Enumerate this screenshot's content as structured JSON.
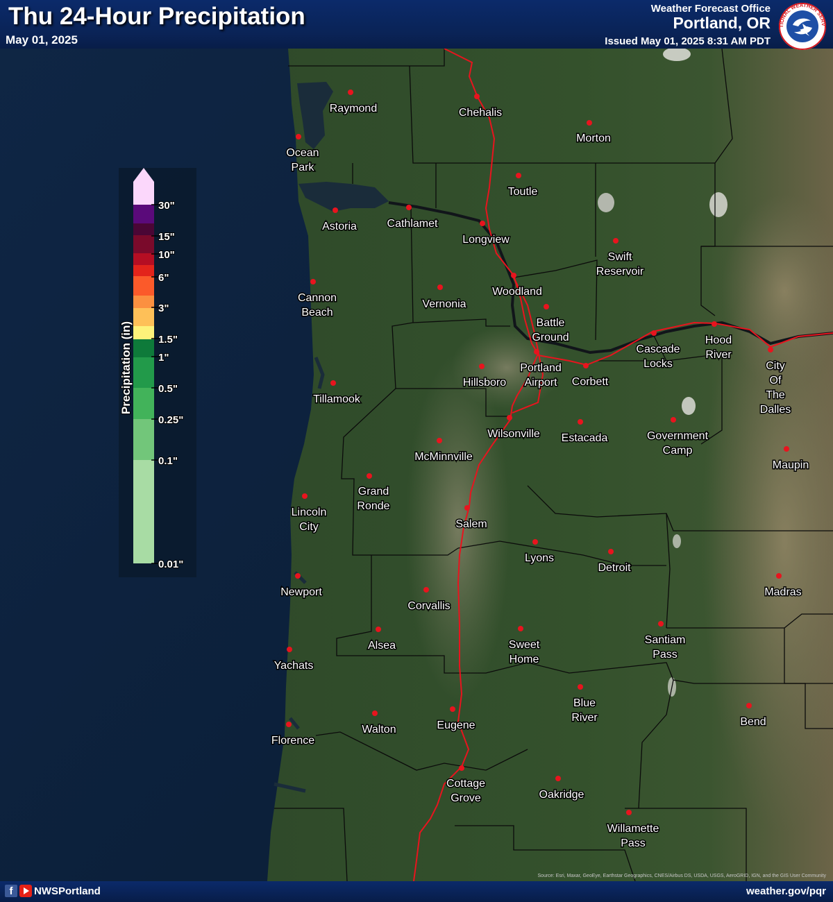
{
  "header": {
    "title": "Thu 24-Hour Precipitation",
    "date": "May 01, 2025",
    "office_line1": "Weather Forecast Office",
    "office_line2": "Portland, OR",
    "issued": "Issued May 01, 2025 8:31 AM PDT"
  },
  "logo_text": "NATIONAL WEATHER SERVICE",
  "legend": {
    "title": "Precipitation (in)",
    "ticks": [
      "30\"",
      "15\"",
      "10\"",
      "6\"",
      "3\"",
      "1.5\"",
      "1\"",
      "0.5\"",
      "0.25\"",
      "0.1\"",
      "0.01\""
    ],
    "colors": [
      "#fbd7fb",
      "#5a0a7a",
      "#4a0635",
      "#7a0a2b",
      "#b50e23",
      "#e3241b",
      "#fb5a2a",
      "#fb9040",
      "#fec058",
      "#fdf27a",
      "#0e7a3a",
      "#229a4a",
      "#42b35a",
      "#72c67a",
      "#a8dca4",
      "#cde9c5"
    ]
  },
  "cities": [
    {
      "name": "Raymond",
      "line2": ""
    },
    {
      "name": "Chehalis",
      "line2": ""
    },
    {
      "name": "Morton",
      "line2": ""
    },
    {
      "name": "Ocean",
      "line2": "Park"
    },
    {
      "name": "Toutle",
      "line2": ""
    },
    {
      "name": "Astoria",
      "line2": ""
    },
    {
      "name": "Cathlamet",
      "line2": ""
    },
    {
      "name": "Longview",
      "line2": ""
    },
    {
      "name": "Swift",
      "line2": "Reservoir"
    },
    {
      "name": "Cannon",
      "line2": "Beach"
    },
    {
      "name": "Vernonia",
      "line2": ""
    },
    {
      "name": "Woodland",
      "line2": ""
    },
    {
      "name": "Battle",
      "line2": "Ground"
    },
    {
      "name": "Hood",
      "line2": "River"
    },
    {
      "name": "Cascade",
      "line2": "Locks"
    },
    {
      "name": "City",
      "line2": "Of"
    },
    {
      "name": "Hillsboro",
      "line2": ""
    },
    {
      "name": "Portland",
      "line2": "Airport"
    },
    {
      "name": "Corbett",
      "line2": ""
    },
    {
      "name": "Tillamook",
      "line2": ""
    },
    {
      "name": "Wilsonville",
      "line2": ""
    },
    {
      "name": "Estacada",
      "line2": ""
    },
    {
      "name": "Government",
      "line2": "Camp"
    },
    {
      "name": "McMinnville",
      "line2": ""
    },
    {
      "name": "Maupin",
      "line2": ""
    },
    {
      "name": "Grand",
      "line2": "Ronde"
    },
    {
      "name": "Lincoln",
      "line2": "City"
    },
    {
      "name": "Salem",
      "line2": ""
    },
    {
      "name": "Lyons",
      "line2": ""
    },
    {
      "name": "Detroit",
      "line2": ""
    },
    {
      "name": "Newport",
      "line2": ""
    },
    {
      "name": "Madras",
      "line2": ""
    },
    {
      "name": "Corvallis",
      "line2": ""
    },
    {
      "name": "Alsea",
      "line2": ""
    },
    {
      "name": "Sweet",
      "line2": "Home"
    },
    {
      "name": "Santiam",
      "line2": "Pass"
    },
    {
      "name": "Yachats",
      "line2": ""
    },
    {
      "name": "Blue",
      "line2": "River"
    },
    {
      "name": "Walton",
      "line2": ""
    },
    {
      "name": "Eugene",
      "line2": ""
    },
    {
      "name": "Bend",
      "line2": ""
    },
    {
      "name": "Florence",
      "line2": ""
    },
    {
      "name": "Cottage",
      "line2": "Grove"
    },
    {
      "name": "Oakridge",
      "line2": ""
    },
    {
      "name": "Willamette",
      "line2": "Pass"
    }
  ],
  "dalles_lines": [
    "The",
    "Dalles"
  ],
  "footer": {
    "handle": "NWSPortland",
    "url": "weather.gov/pqr"
  },
  "attribution": "Source: Esri, Maxar, GeoEye, Earthstar Geographics, CNES/Airbus DS, USDA, USGS, AeroGRID, IGN, and the GIS User Community",
  "colors": {
    "header_bg": "#0a2356",
    "city_dot": "#e8141e",
    "interstate": "#e8141e",
    "ocean": "#0d2038"
  }
}
